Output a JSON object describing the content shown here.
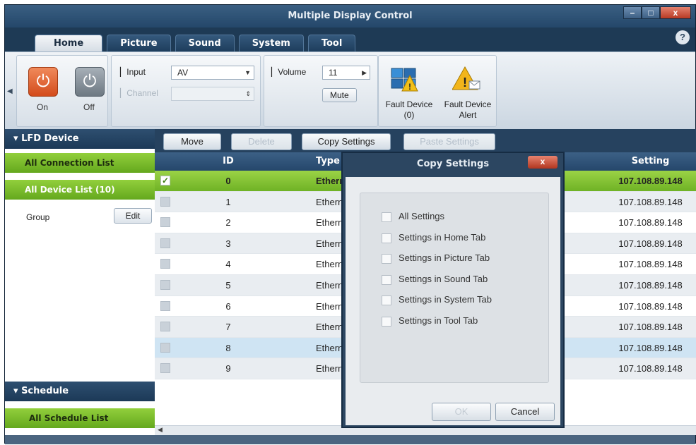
{
  "window": {
    "title": "Multiple Display Control",
    "controls": [
      "–",
      "□",
      "x"
    ]
  },
  "tabs": [
    "Home",
    "Picture",
    "Sound",
    "System",
    "Tool"
  ],
  "help_label": "?",
  "ribbon": {
    "power": {
      "on_label": "On",
      "off_label": "Off",
      "on_icon": "power-icon",
      "off_icon": "power-icon",
      "glyph": "⏻"
    },
    "input_label": "Input",
    "input_value": "AV",
    "channel_label": "Channel",
    "channel_value": "",
    "volume_label": "Volume",
    "volume_value": "11",
    "mute_label": "Mute",
    "fault_device_label": "Fault Device",
    "fault_device_count": "(0)",
    "fault_alert_label": "Fault Device",
    "fault_alert_label2": "Alert"
  },
  "sidebar": {
    "lfd_header": "LFD Device",
    "all_connection": "All Connection List",
    "all_device": "All Device List (10)",
    "group_label": "Group",
    "edit_label": "Edit",
    "schedule_header": "Schedule",
    "all_schedule": "All Schedule List"
  },
  "toolbar": {
    "move": "Move",
    "delete": "Delete",
    "copy_settings": "Copy Settings",
    "paste_settings": "Paste Settings"
  },
  "table": {
    "columns": [
      "ID",
      "Type",
      "Setting"
    ],
    "rows": [
      {
        "id": "0",
        "type": "Ethern",
        "setting": "107.108.89.148",
        "checked": true
      },
      {
        "id": "1",
        "type": "Ethern",
        "setting": "107.108.89.148",
        "checked": false
      },
      {
        "id": "2",
        "type": "Ethern",
        "setting": "107.108.89.148",
        "checked": false
      },
      {
        "id": "3",
        "type": "Ethern",
        "setting": "107.108.89.148",
        "checked": false
      },
      {
        "id": "4",
        "type": "Ethern",
        "setting": "107.108.89.148",
        "checked": false
      },
      {
        "id": "5",
        "type": "Ethern",
        "setting": "107.108.89.148",
        "checked": false
      },
      {
        "id": "6",
        "type": "Ethern",
        "setting": "107.108.89.148",
        "checked": false
      },
      {
        "id": "7",
        "type": "Ethern",
        "setting": "107.108.89.148",
        "checked": false
      },
      {
        "id": "8",
        "type": "Ethern",
        "setting": "107.108.89.148",
        "checked": false
      },
      {
        "id": "9",
        "type": "Ethern",
        "setting": "107.108.89.148",
        "checked": false
      }
    ]
  },
  "dialog": {
    "title": "Copy Settings",
    "close_label": "x",
    "options": [
      "All Settings",
      "Settings in Home Tab",
      "Settings in Picture Tab",
      "Settings in Sound Tab",
      "Settings in System Tab",
      "Settings in Tool Tab"
    ],
    "ok_label": "OK",
    "cancel_label": "Cancel"
  }
}
